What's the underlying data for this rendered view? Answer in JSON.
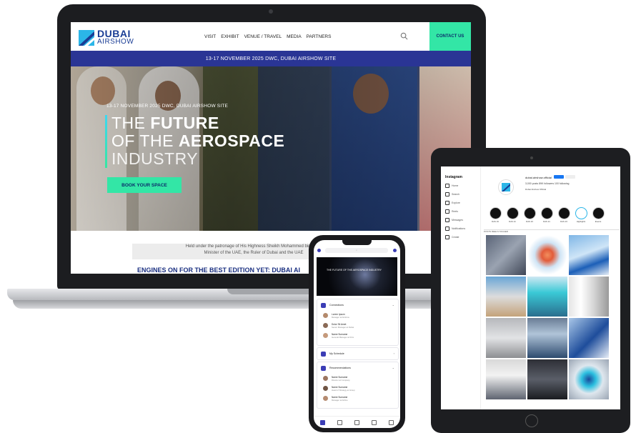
{
  "site": {
    "logo_top": "DUBAI",
    "logo_bottom": "AIRSHOW",
    "nav": [
      "VISIT",
      "EXHIBIT",
      "VENUE / TRAVEL",
      "MEDIA",
      "PARTNERS"
    ],
    "contact": "CONTACT US",
    "date_bar": "13-17 NOVEMBER 2025 DWC, DUBAI AIRSHOW SITE",
    "hero_sub": "13-17 NOVEMBER 2025 DWC, DUBAI AIRSHOW SITE",
    "hero_line1_light": "THE",
    "hero_line1_bold": "FUTURE",
    "hero_line2_light": "OF THE",
    "hero_line2_bold": "AEROSPACE",
    "hero_line3": "INDUSTRY",
    "cta": "BOOK YOUR SPACE",
    "patronage_1": "Held under the patronage of His Highness Sheikh Mohammed bin Rash",
    "patronage_2": "Minister of the UAE, the Ruler of Dubai and the UAE",
    "engines": "ENGINES ON FOR THE BEST EDITION YET: DUBAI AI"
  },
  "colors": {
    "brand_blue": "#1a3d95",
    "date_bar": "#2a3595",
    "accent_green": "#33e6a6"
  },
  "phone": {
    "hero_text": "THE FUTURE OF THE AEROSPACE INDUSTRY",
    "cards": [
      {
        "title": "Connections",
        "rows": [
          {
            "name": "Lorem Ipsum",
            "role": "Manager at Airshow"
          },
          {
            "name": "Dolor Sit Amet",
            "role": "Senior Manager at Dubai"
          },
          {
            "name": "Name Surname",
            "role": "General Manager at Firm"
          }
        ]
      },
      {
        "title": "My Schedule",
        "rows": []
      },
      {
        "title": "Recommendations",
        "rows": [
          {
            "name": "Name Surname",
            "role": "Director at Company"
          },
          {
            "name": "Name Surname",
            "role": "Head of Strategy at Group"
          },
          {
            "name": "Name Surname",
            "role": "Manager at Airline"
          }
        ]
      }
    ]
  },
  "tablet": {
    "ig_logo": "Instagram",
    "ig_nav": [
      "Home",
      "Search",
      "Explore",
      "Reels",
      "Messages",
      "Notifications",
      "Create"
    ],
    "profile_name": "dubai.airshow.official",
    "stats": "3,000 posts  89K followers  100 following",
    "bio": "Dubai Airshow Official",
    "highlights": [
      "DAS 19",
      "DAS 21",
      "DAS 23",
      "DAS 21",
      "DAS 23",
      "Highlights",
      "Events"
    ],
    "tabs": "POSTS   REELS   TAGGED"
  }
}
